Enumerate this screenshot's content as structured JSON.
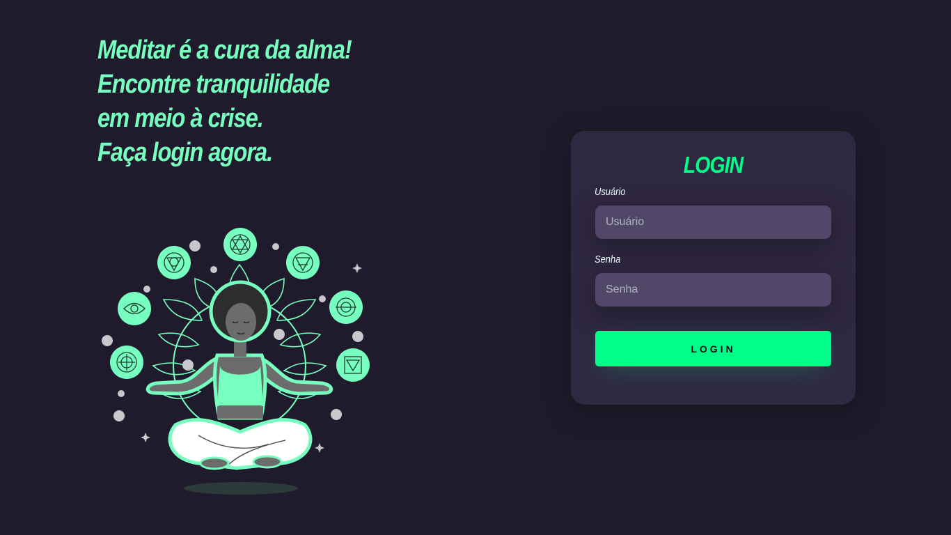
{
  "headline": {
    "lines": [
      "Meditar é a cura da alma!",
      "Encontre tranquilidade",
      "em meio à crise.",
      "Faça login agora."
    ]
  },
  "illustration": {
    "icon": "meditating-woman-chakras-illustration"
  },
  "login": {
    "title": "LOGIN",
    "username_label": "Usuário",
    "username_placeholder": "Usuário",
    "password_label": "Senha",
    "password_placeholder": "Senha",
    "button_label": "LOGIN"
  },
  "colors": {
    "background": "#201b2c",
    "accent": "#00ff88",
    "headline": "#77ffc0",
    "card": "#2f2841",
    "input": "#514869"
  }
}
